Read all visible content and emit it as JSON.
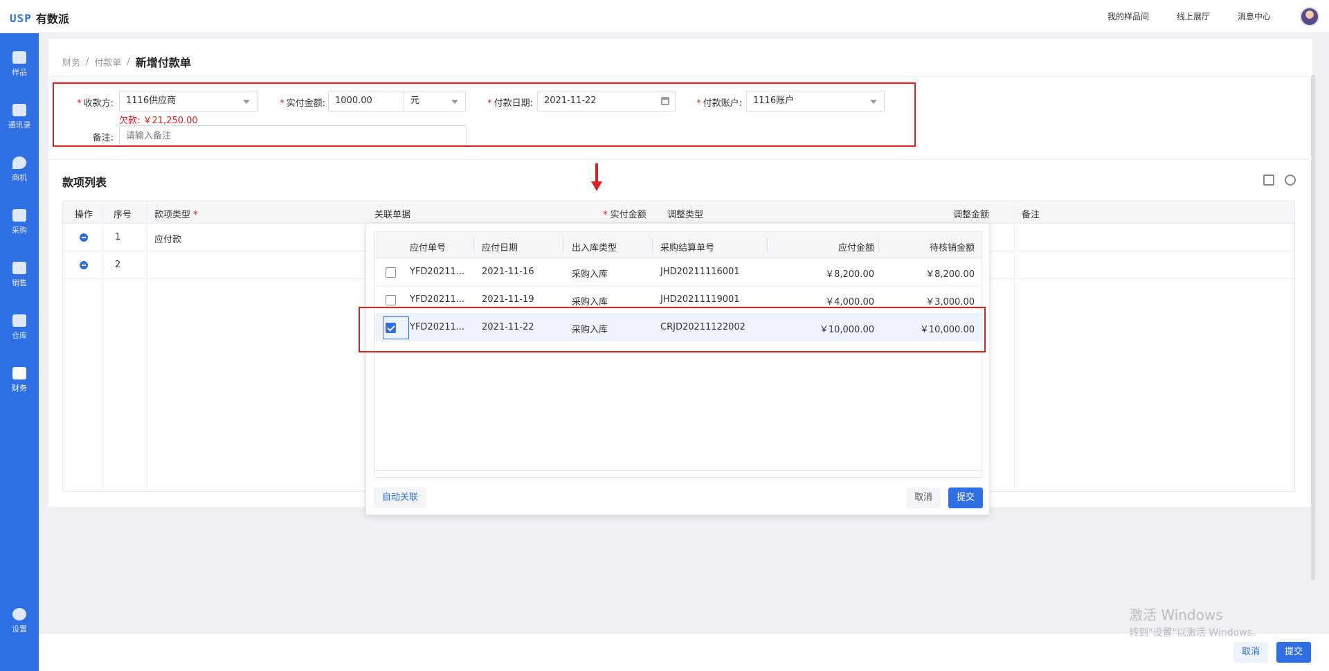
{
  "brand": {
    "logo_mark": "USP",
    "name": "有数派"
  },
  "top_links": [
    "我的样品间",
    "线上展厅",
    "消息中心"
  ],
  "nav": [
    {
      "label": "样品",
      "icon": "sample-icon"
    },
    {
      "label": "通讯录",
      "icon": "contacts-icon"
    },
    {
      "label": "商机",
      "icon": "opportunity-icon"
    },
    {
      "label": "采购",
      "icon": "purchase-icon"
    },
    {
      "label": "销售",
      "icon": "sales-icon"
    },
    {
      "label": "仓库",
      "icon": "warehouse-icon"
    },
    {
      "label": "财务",
      "icon": "finance-icon",
      "active": true
    },
    {
      "label": "设置",
      "icon": "settings-icon"
    }
  ],
  "breadcrumb": {
    "root": "财务",
    "sep": "/",
    "parent": "付款单",
    "current": "新增付款单"
  },
  "form": {
    "payee_label": "收款方:",
    "payee_value": "1116供应商",
    "amount_label": "实付金额:",
    "amount_value": "1000.00",
    "currency_value": "元",
    "date_label": "付款日期:",
    "date_value": "2021-11-22",
    "account_label": "付款账户:",
    "account_value": "1116账户",
    "debt_text": "欠款: ￥21,250.00",
    "remark_label": "备注:",
    "remark_placeholder": "请输入备注",
    "required_mark": "*"
  },
  "items_section": {
    "title": "款项列表",
    "columns": [
      "操作",
      "序号",
      "款项类型",
      "关联单据",
      "实付金额",
      "调整类型",
      "调整金额",
      "备注"
    ],
    "rows": [
      {
        "index": "1",
        "type": "应付款"
      },
      {
        "index": "2",
        "type": ""
      }
    ]
  },
  "popover": {
    "columns": [
      "应付单号",
      "应付日期",
      "出入库类型",
      "采购结算单号",
      "应付金额",
      "待核销金额"
    ],
    "rows": [
      {
        "checked": false,
        "no": "YFD20211...",
        "date": "2021-11-16",
        "io_type": "采购入库",
        "settle_no": "JHD20211116001",
        "amount": "￥8,200.00",
        "pending": "￥8,200.00"
      },
      {
        "checked": false,
        "no": "YFD20211...",
        "date": "2021-11-19",
        "io_type": "采购入库",
        "settle_no": "JHD20211119001",
        "amount": "￥4,000.00",
        "pending": "￥3,000.00"
      },
      {
        "checked": true,
        "no": "YFD20211...",
        "date": "2021-11-22",
        "io_type": "采购入库",
        "settle_no": "CRJD20211122002",
        "amount": "￥10,000.00",
        "pending": "￥10,000.00"
      }
    ],
    "auto_link_label": "自动关联",
    "cancel_label": "取消",
    "submit_label": "提交"
  },
  "footer": {
    "cancel_label": "取消",
    "submit_label": "提交"
  },
  "watermark": {
    "line1": "激活 Windows",
    "line2": "转到\"设置\"以激活 Windows。"
  },
  "colors": {
    "primary": "#2f6fe4",
    "danger": "#e02020"
  }
}
